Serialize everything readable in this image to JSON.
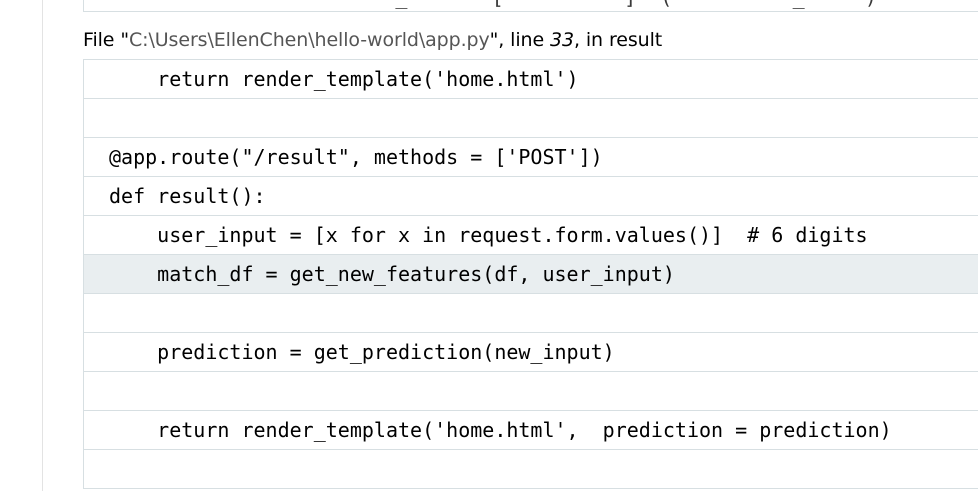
{
  "top_partial_line": "        _       [          ]  (          _     )",
  "frame": {
    "file_prefix": "File \"",
    "file_path": "C:\\Users\\EllenChen\\hello-world\\app.py",
    "file_suffix": "\", line ",
    "line_number": "33",
    "in_text": ", in ",
    "function_name": "result"
  },
  "code_lines": [
    {
      "text": "    return render_template('home.html')",
      "current": false
    },
    {
      "text": "",
      "current": false
    },
    {
      "text": "@app.route(\"/result\", methods = ['POST'])",
      "current": false
    },
    {
      "text": "def result():",
      "current": false
    },
    {
      "text": "    user_input = [x for x in request.form.values()]  # 6 digits",
      "current": false
    },
    {
      "text": "    match_df = get_new_features(df, user_input)",
      "current": true
    },
    {
      "text": "",
      "current": false
    },
    {
      "text": "    prediction = get_prediction(new_input)",
      "current": false
    },
    {
      "text": "",
      "current": false
    },
    {
      "text": "    return render_template('home.html',  prediction = prediction)",
      "current": false
    },
    {
      "text": "",
      "current": false
    }
  ]
}
